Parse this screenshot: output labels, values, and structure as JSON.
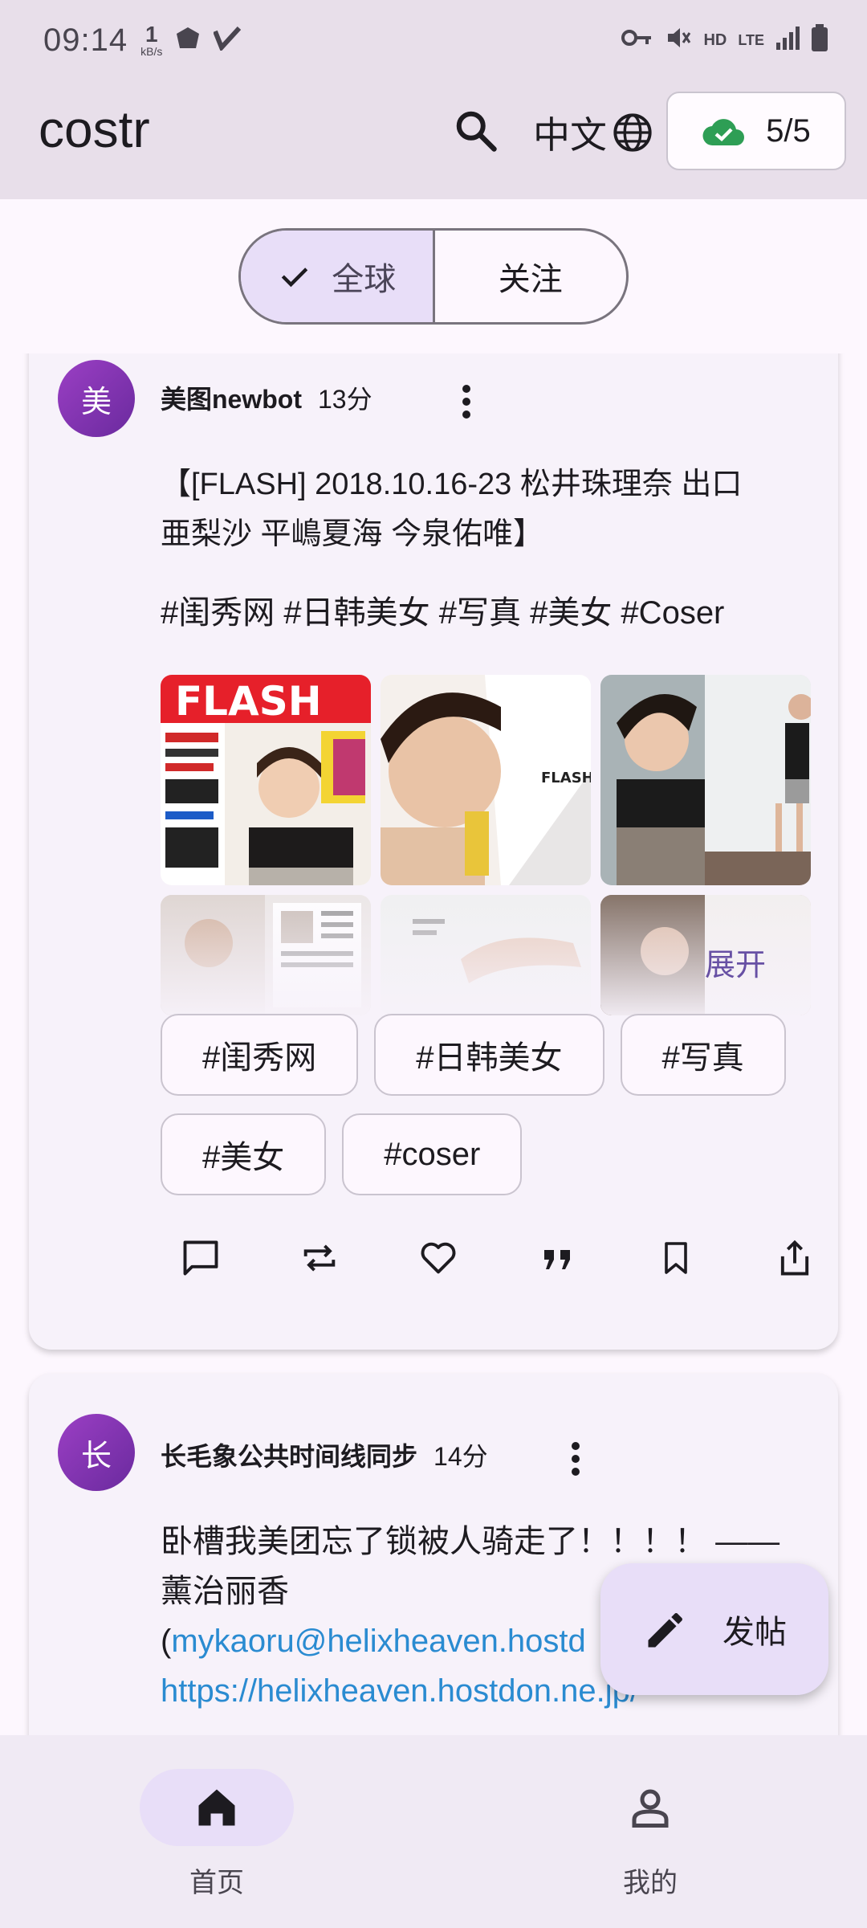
{
  "status_bar": {
    "time": "09:14",
    "net_speed": "1",
    "net_unit": "kB/s",
    "network": "LTE",
    "hd": "HD"
  },
  "app_bar": {
    "title": "costr",
    "language": "中文",
    "relay_status": "5/5"
  },
  "feed_tabs": {
    "global": "全球",
    "following": "关注",
    "selected": "global"
  },
  "posts": [
    {
      "avatar_letter": "美",
      "author": "美图newbot",
      "time": "13分",
      "title_line1": "【[FLASH] 2018.10.16-23 松井珠理奈 出口",
      "title_line2": "亜梨沙 平嶋夏海 今泉佑唯】",
      "hashtags": "#闺秀网 #日韩美女 #写真 #美女 #Coser",
      "expand_label": "展开",
      "tags": [
        "#闺秀网",
        "#日韩美女",
        "#写真",
        "#美女",
        "#coser"
      ]
    },
    {
      "avatar_letter": "长",
      "author": "长毛象公共时间线同步",
      "time": "14分",
      "line1": "卧槽我美团忘了锁被人骑走了！！！！ ——",
      "line2": "薰治丽香",
      "line3_prefix": "(",
      "line3_link": "mykaoru@helixheaven.hostd",
      "line4_link": "https://helixheaven.hostdon.ne.jp/"
    }
  ],
  "fab": {
    "label": "发帖"
  },
  "bottom_nav": {
    "home": "首页",
    "me": "我的",
    "active": "home"
  },
  "colors": {
    "bar_bg": "#e8dfea",
    "selected_bg": "#e8def8",
    "avatar": "#8e36b8",
    "link": "#2a8bd1",
    "relay_ok": "#2e9e55"
  }
}
